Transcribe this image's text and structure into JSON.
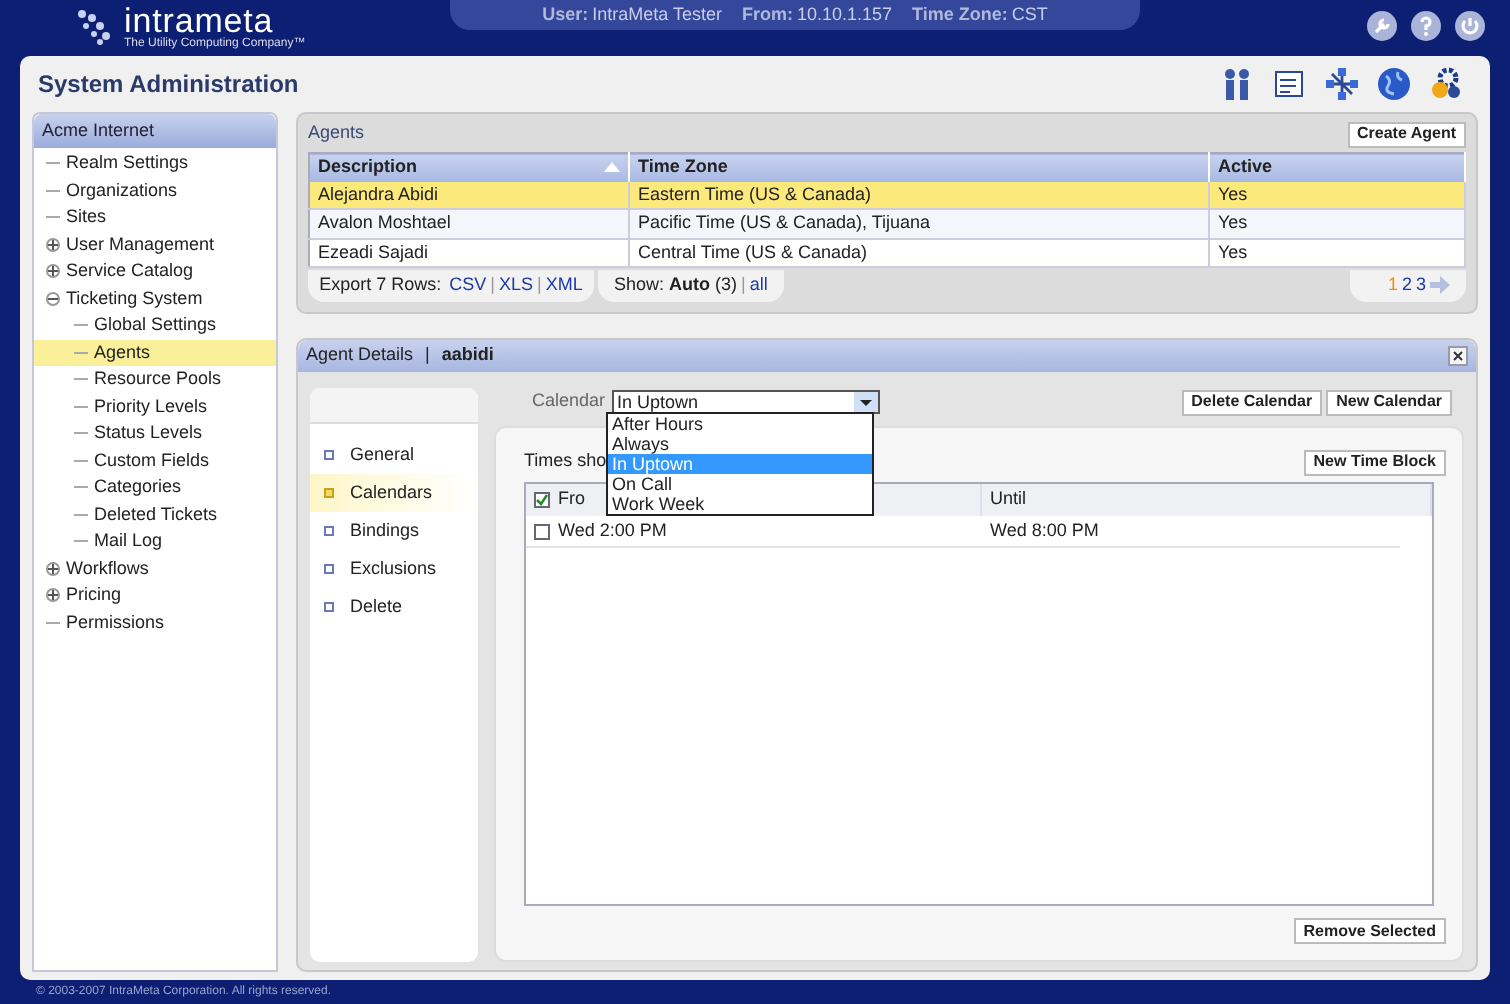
{
  "header": {
    "logo_text": "intrameta",
    "tagline": "The Utility Computing Company™",
    "info": [
      {
        "label": "User:",
        "value": "IntraMeta Tester"
      },
      {
        "label": "From:",
        "value": "10.10.1.157"
      },
      {
        "label": "Time Zone:",
        "value": "CST"
      }
    ]
  },
  "page_title": "System Administration",
  "sidebar": {
    "title": "Acme Internet",
    "items": [
      {
        "label": "Realm Settings",
        "selected": false
      },
      {
        "label": "Organizations",
        "selected": false
      },
      {
        "label": "Sites",
        "selected": false
      },
      {
        "label": "User Management",
        "selected": false,
        "expanded": false
      },
      {
        "label": "Service Catalog",
        "selected": false,
        "expanded": false
      },
      {
        "label": "Ticketing System",
        "selected": false,
        "expanded": true,
        "children": [
          {
            "label": "Global Settings",
            "selected": false
          },
          {
            "label": "Agents",
            "selected": true
          },
          {
            "label": "Resource Pools",
            "selected": false
          },
          {
            "label": "Priority Levels",
            "selected": false
          },
          {
            "label": "Status Levels",
            "selected": false
          },
          {
            "label": "Custom Fields",
            "selected": false
          },
          {
            "label": "Categories",
            "selected": false
          },
          {
            "label": "Deleted Tickets",
            "selected": false
          },
          {
            "label": "Mail Log",
            "selected": false
          }
        ]
      },
      {
        "label": "Workflows",
        "selected": false,
        "expanded": false
      },
      {
        "label": "Pricing",
        "selected": false,
        "expanded": false
      },
      {
        "label": "Permissions",
        "selected": false
      }
    ]
  },
  "agents": {
    "title": "Agents",
    "create_button": "Create Agent",
    "columns": [
      {
        "label": "Description",
        "sorted": true
      },
      {
        "label": "Time Zone"
      },
      {
        "label": "Active"
      }
    ],
    "rows": [
      {
        "cells": [
          "Alejandra Abidi",
          "Eastern Time (US & Canada)",
          "Yes"
        ],
        "selected": true
      },
      {
        "cells": [
          "Avalon Moshtael",
          "Pacific Time (US & Canada), Tijuana",
          "Yes"
        ],
        "selected": false
      },
      {
        "cells": [
          "Ezeadi Sajadi",
          "Central Time (US & Canada)",
          "Yes"
        ],
        "selected": false
      }
    ],
    "export_label": "Export 7 Rows:",
    "export_links": [
      "CSV",
      "XLS",
      "XML"
    ],
    "link_separator": "|",
    "show_text": "Show: **Auto** (3)",
    "show_separator": "|",
    "show_link": "all",
    "pages": [
      {
        "label": "1",
        "selected": true
      },
      {
        "label": "2",
        "selected": false
      },
      {
        "label": "3",
        "selected": false
      }
    ]
  },
  "details": {
    "title": "Agent Details",
    "separator": "|",
    "agent": "aabidi",
    "tabs": [
      {
        "label": "General",
        "selected": false
      },
      {
        "label": "Calendars",
        "selected": true
      },
      {
        "label": "Bindings",
        "selected": false
      },
      {
        "label": "Exclusions",
        "selected": false
      },
      {
        "label": "Delete",
        "selected": false
      }
    ],
    "calendar_label": "Calendar",
    "calendar_value": "In Uptown",
    "calendar_options": [
      {
        "label": "After Hours",
        "selected": false
      },
      {
        "label": "Always",
        "selected": false
      },
      {
        "label": "In Uptown",
        "selected": true
      },
      {
        "label": "On Call",
        "selected": false
      },
      {
        "label": "Work Week",
        "selected": false
      }
    ],
    "buttons": [
      "Delete Calendar",
      "New Calendar"
    ],
    "times_label": "Times sho",
    "new_block_button": "New Time Block",
    "times_columns": [
      {
        "label": "Fro",
        "checked": true
      },
      {
        "label": "Until"
      }
    ],
    "times_rows": [
      {
        "checked": false,
        "cells": [
          "Wed 2:00 PM",
          "Wed 8:00 PM"
        ]
      }
    ],
    "remove_button": "Remove Selected"
  },
  "footer": "© 2003-2007 IntraMeta Corporation.  All rights reserved."
}
